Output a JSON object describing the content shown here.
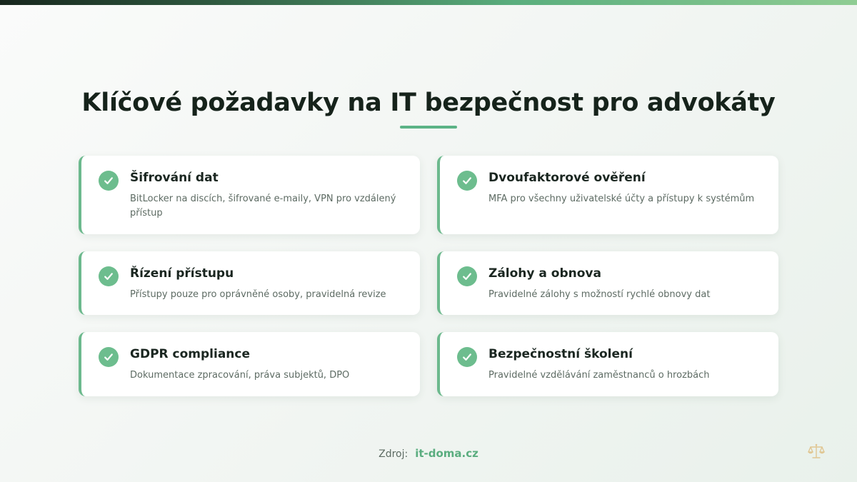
{
  "title": "Klíčové požadavky na IT bezpečnost pro advokáty",
  "cards": [
    {
      "title": "Šifrování dat",
      "text": "BitLocker na discích, šifrované e-maily, VPN pro vzdálený přístup"
    },
    {
      "title": "Dvoufaktorové ověření",
      "text": "MFA pro všechny uživatelské účty a přístupy k systémům"
    },
    {
      "title": "Řízení přístupu",
      "text": "Přístupy pouze pro oprávněné osoby, pravidelná revize"
    },
    {
      "title": "Zálohy a obnova",
      "text": "Pravidelné zálohy s možností rychlé obnovy dat"
    },
    {
      "title": "GDPR compliance",
      "text": "Dokumentace zpracování, práva subjektů, DPO"
    },
    {
      "title": "Bezpečnostní školení",
      "text": "Pravidelné vzdělávání zaměstnanců o hrozbách"
    }
  ],
  "source": {
    "label": "Zdroj:",
    "link": "it-doma.cz"
  },
  "icons": {
    "check": "check-circle-icon",
    "logo": "scales-of-justice-icon"
  },
  "colors": {
    "accent": "#6cb98d",
    "title": "#16231b",
    "link": "#5aad7f"
  }
}
